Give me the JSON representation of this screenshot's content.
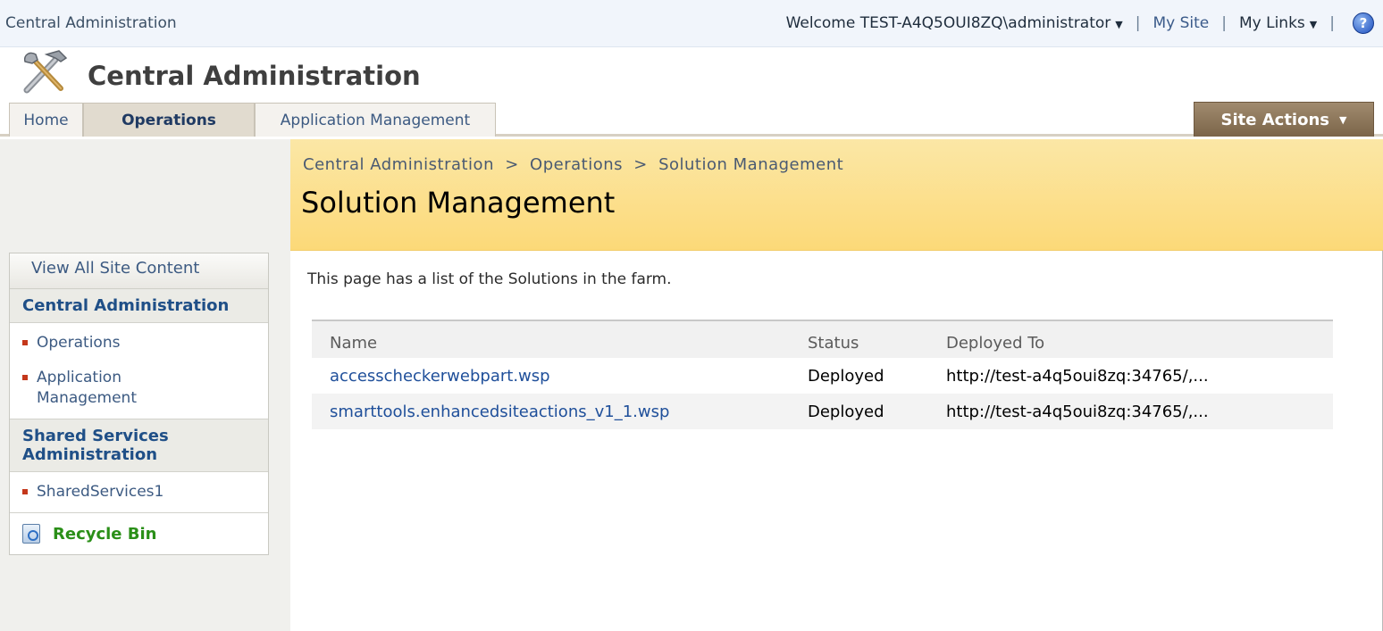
{
  "global": {
    "site_label": "Central Administration",
    "welcome": "Welcome TEST-A4Q5OUI8ZQ\\administrator",
    "my_site": "My Site",
    "my_links": "My Links",
    "separator": "|"
  },
  "header": {
    "site_title": "Central Administration"
  },
  "tabs": [
    {
      "label": "Home",
      "active": false
    },
    {
      "label": "Operations",
      "active": true
    },
    {
      "label": "Application Management",
      "active": false
    }
  ],
  "site_actions": {
    "label": "Site Actions"
  },
  "breadcrumb": {
    "items": [
      "Central Administration",
      "Operations",
      "Solution Management"
    ],
    "separator": ">"
  },
  "page": {
    "title": "Solution Management",
    "intro": "This page has a list of the Solutions in the farm."
  },
  "table": {
    "headers": [
      "Name",
      "Status",
      "Deployed To"
    ],
    "rows": [
      {
        "name": "accesscheckerwebpart.wsp",
        "status": "Deployed",
        "deployed_to": "http://test-a4q5oui8zq:34765/,..."
      },
      {
        "name": "smarttools.enhancedsiteactions_v1_1.wsp",
        "status": "Deployed",
        "deployed_to": "http://test-a4q5oui8zq:34765/,..."
      }
    ]
  },
  "quick_launch": {
    "view_all": "View All Site Content",
    "groups": [
      {
        "heading": "Central Administration",
        "items": [
          "Operations",
          "Application Management"
        ]
      },
      {
        "heading": "Shared Services Administration",
        "items": [
          "SharedServices1"
        ]
      }
    ],
    "recycle_bin": "Recycle Bin"
  },
  "colors": {
    "link": "#3c5a82",
    "header_yellow": "#fcd978",
    "site_actions_brown": "#7b6449",
    "recycle_green": "#2a8f18"
  },
  "icons": {
    "title_icon": "tools-icon",
    "help_icon": "help-icon",
    "recycle_icon": "recycle-bin-icon"
  }
}
